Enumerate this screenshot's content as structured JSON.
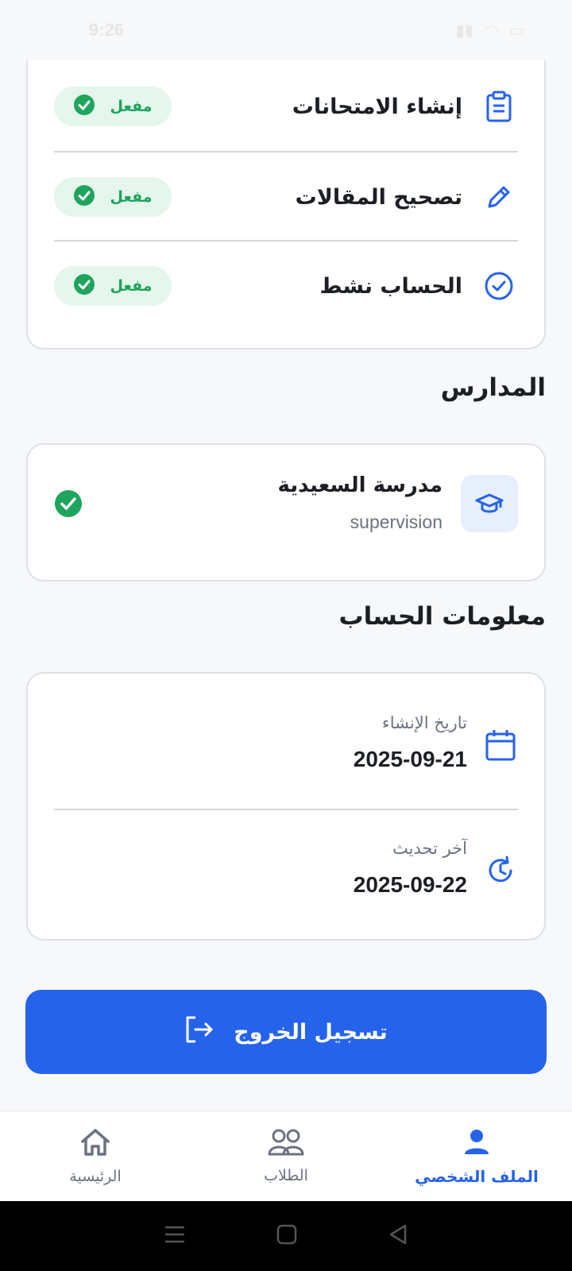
{
  "status_bar": {
    "time": "9:26"
  },
  "permissions": [
    {
      "label": "إنشاء الامتحانات",
      "status": "مفعل",
      "icon": "clipboard-icon"
    },
    {
      "label": "تصحيح المقالات",
      "status": "مفعل",
      "icon": "pencil-icon"
    },
    {
      "label": "الحساب نشط",
      "status": "مفعل",
      "icon": "check-circle-icon"
    }
  ],
  "schools_section": {
    "title": "المدارس",
    "school": {
      "name": "مدرسة السعيدية",
      "role": "supervision",
      "icon": "graduation-cap-icon"
    }
  },
  "account_section": {
    "title": "معلومات الحساب",
    "created": {
      "label": "تاريخ الإنشاء",
      "value": "2025-09-21",
      "icon": "calendar-icon"
    },
    "updated": {
      "label": "آخر تحديث",
      "value": "2025-09-22",
      "icon": "clock-refresh-icon"
    }
  },
  "logout": {
    "label": "تسجيل الخروج",
    "icon": "logout-icon"
  },
  "bottom_nav": {
    "items": [
      {
        "label": "الملف الشخصي",
        "icon": "profile-icon",
        "active": true
      },
      {
        "label": "الطلاب",
        "icon": "students-icon",
        "active": false
      },
      {
        "label": "الرئيسية",
        "icon": "home-icon",
        "active": false
      }
    ]
  },
  "colors": {
    "primary": "#2563eb",
    "success": "#1fa45c",
    "success_bg": "#e5f6ec"
  }
}
